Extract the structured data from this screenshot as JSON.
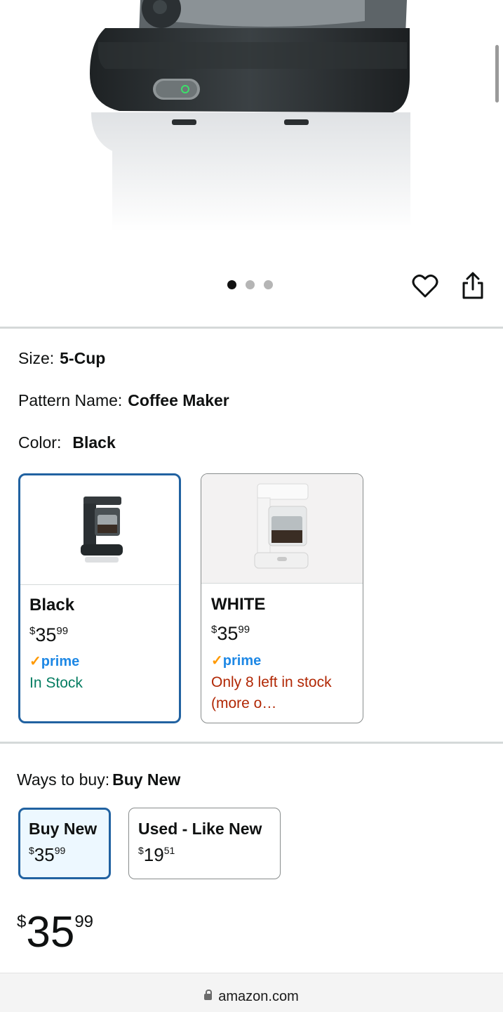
{
  "gallery": {
    "image_alt": "Black 5-Cup Coffee Maker",
    "dots": [
      true,
      false,
      false
    ],
    "icons": [
      "heart-icon",
      "share-icon"
    ]
  },
  "attributes": {
    "size_label": "Size:",
    "size_value": "5-Cup",
    "pattern_label": "Pattern Name:",
    "pattern_value": "Coffee Maker",
    "color_label": "Color:",
    "color_value": "Black"
  },
  "swatches": [
    {
      "name": "Black",
      "currency": "$",
      "price_whole": "35",
      "price_fraction": "99",
      "prime": "prime",
      "availability": "In Stock",
      "selected": true
    },
    {
      "name": "WHITE",
      "currency": "$",
      "price_whole": "35",
      "price_fraction": "99",
      "prime": "prime",
      "availability": "Only 8 left in stock (more o…",
      "selected": false
    }
  ],
  "ways_to_buy": {
    "label": "Ways to buy:",
    "value": "Buy New",
    "options": [
      {
        "label": "Buy New",
        "currency": "$",
        "price_whole": "35",
        "price_fraction": "99",
        "selected": true
      },
      {
        "label": "Used - Like New",
        "currency": "$",
        "price_whole": "19",
        "price_fraction": "51",
        "selected": false
      }
    ]
  },
  "price": {
    "currency": "$",
    "whole": "35",
    "fraction": "99"
  },
  "browser": {
    "url": "amazon.com"
  },
  "colors": {
    "accent": "#2162a1",
    "prime_blue": "#1e88e5",
    "in_stock": "#067d62",
    "low_stock": "#b12704",
    "prime_check": "#ff9900"
  }
}
